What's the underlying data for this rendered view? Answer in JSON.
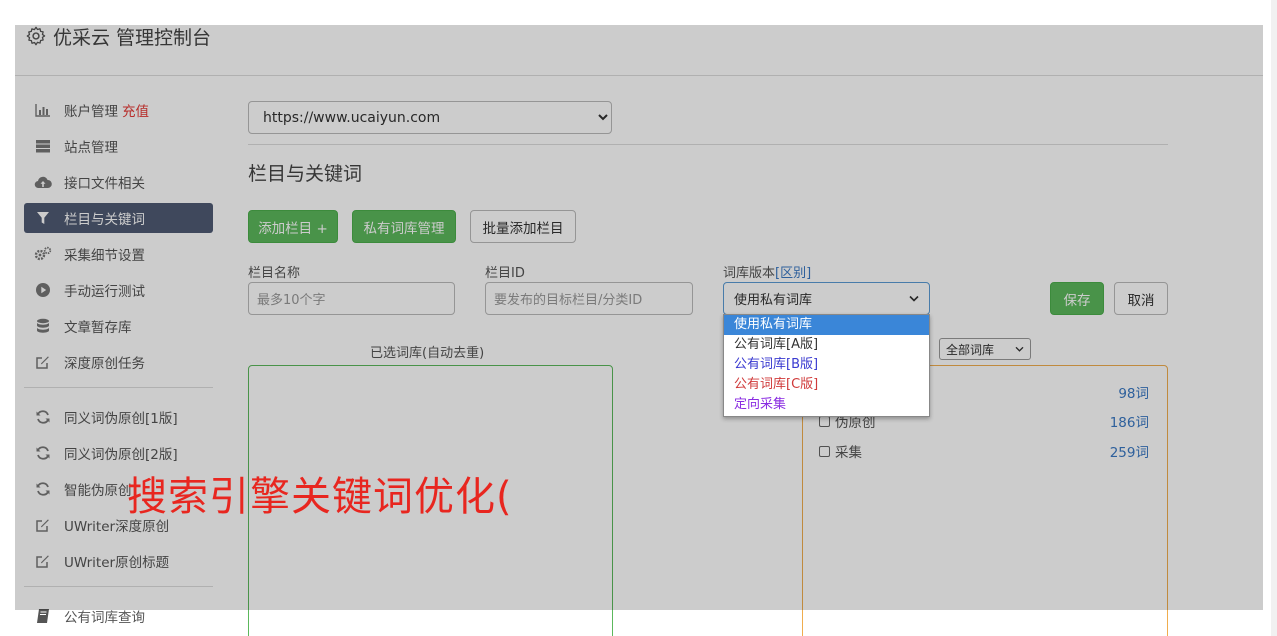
{
  "header": {
    "title": "优采云 管理控制台"
  },
  "sidebar": {
    "groups": [
      [
        {
          "label": "账户管理",
          "badge": "充值",
          "icon": "bar-chart-icon"
        },
        {
          "label": "站点管理",
          "icon": "server-icon"
        },
        {
          "label": "接口文件相关",
          "icon": "cloud-upload-icon"
        },
        {
          "label": "栏目与关键词",
          "icon": "filter-icon",
          "active": true
        },
        {
          "label": "采集细节设置",
          "icon": "gears-icon"
        },
        {
          "label": "手动运行测试",
          "icon": "play-circle-icon"
        },
        {
          "label": "文章暂存库",
          "icon": "database-icon"
        },
        {
          "label": "深度原创任务",
          "icon": "edit-icon"
        }
      ],
      [
        {
          "label": "同义词伪原创[1版]",
          "icon": "refresh-icon"
        },
        {
          "label": "同义词伪原创[2版]",
          "icon": "refresh-icon"
        },
        {
          "label": "智能伪原创",
          "icon": "refresh-icon"
        },
        {
          "label": "UWriter深度原创",
          "icon": "edit-icon"
        },
        {
          "label": "UWriter原创标题",
          "icon": "edit-icon"
        }
      ],
      [
        {
          "label": "公有词库查询",
          "icon": "book-icon"
        }
      ]
    ]
  },
  "main": {
    "site_select": "https://www.ucaiyun.com",
    "section_title": "栏目与关键词",
    "buttons": {
      "add_column": "添加栏目 +",
      "private_lib": "私有词库管理",
      "batch_add": "批量添加栏目",
      "save": "保存",
      "cancel": "取消"
    },
    "form": {
      "column_name_label": "栏目名称",
      "column_name_placeholder": "最多10个字",
      "column_id_label": "栏目ID",
      "column_id_placeholder": "要发布的目标栏目/分类ID",
      "lib_version_label": "词库版本",
      "lib_version_link": "[区别]",
      "lib_version_value": "使用私有词库"
    },
    "dropdown_options": [
      {
        "label": "使用私有词库",
        "color": "#ffffff",
        "selected": true
      },
      {
        "label": "公有词库[A版]",
        "color": "#333333"
      },
      {
        "label": "公有词库[B版]",
        "color": "#3a3ad0"
      },
      {
        "label": "公有词库[C版]",
        "color": "#d03a3a"
      },
      {
        "label": "定向采集",
        "color": "#8a2be2"
      }
    ],
    "selected_panel_title": "已选词库(自动去重)",
    "filter_select": "全部词库",
    "library_rows": [
      {
        "name": "",
        "count": "98词"
      },
      {
        "name": "伪原创",
        "count": "186词"
      },
      {
        "name": "采集",
        "count": "259词"
      }
    ]
  },
  "watermark": "搜索引擎关键词优化("
}
